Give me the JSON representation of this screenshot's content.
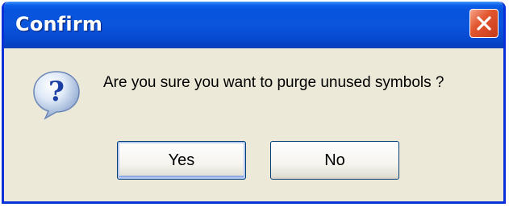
{
  "dialog": {
    "title": "Confirm",
    "message": "Are you sure you want to purge unused symbols ?",
    "icon": "question-icon",
    "buttons": {
      "yes_label": "Yes",
      "no_label": "No"
    },
    "close_icon": "close-icon"
  },
  "colors": {
    "titlebar": "#0a55dc",
    "window_border": "#0831d9",
    "dialog_background": "#ece9d8",
    "close_button": "#e2572f"
  }
}
